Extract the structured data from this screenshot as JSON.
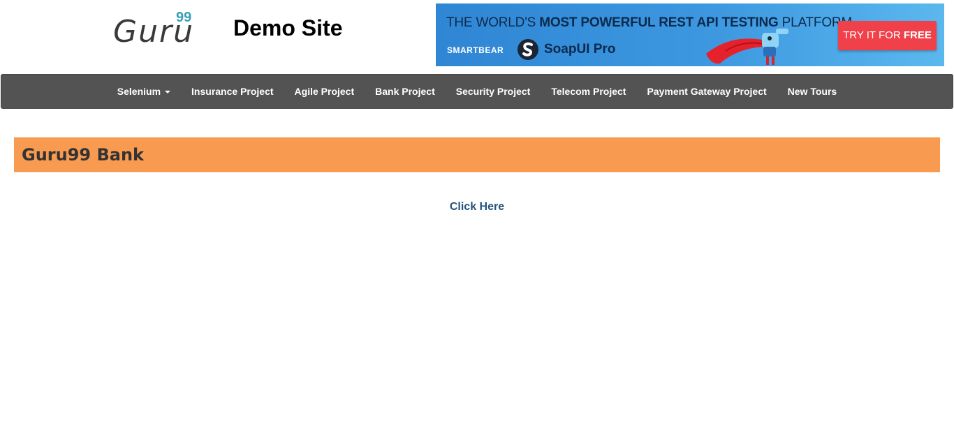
{
  "header": {
    "logo": {
      "word": "Guru",
      "superscript": "99"
    },
    "site_title": "Demo Site"
  },
  "banner": {
    "headline_parts": [
      "THE WORLD'S ",
      "MOST POWERFUL",
      " REST API TESTING ",
      "PLATFORM"
    ],
    "brand": "SMARTBEAR",
    "product": "SoapUI Pro",
    "cta_prefix": "TRY IT FOR ",
    "cta_emphasis": "FREE"
  },
  "navbar": {
    "items": [
      {
        "label": "Selenium",
        "has_caret": true
      },
      {
        "label": "Insurance Project"
      },
      {
        "label": "Agile Project"
      },
      {
        "label": "Bank Project"
      },
      {
        "label": "Security Project"
      },
      {
        "label": "Telecom Project"
      },
      {
        "label": "Payment Gateway Project"
      },
      {
        "label": "New Tours"
      }
    ]
  },
  "main": {
    "bank_title": "Guru99 Bank",
    "link_label": "Click Here"
  },
  "colors": {
    "navbar_bg": "#535353",
    "bank_bar_bg": "#f89b50",
    "link": "#25537c",
    "cta_bg": "#f0414b",
    "logo_accent": "#3a9fb6"
  }
}
